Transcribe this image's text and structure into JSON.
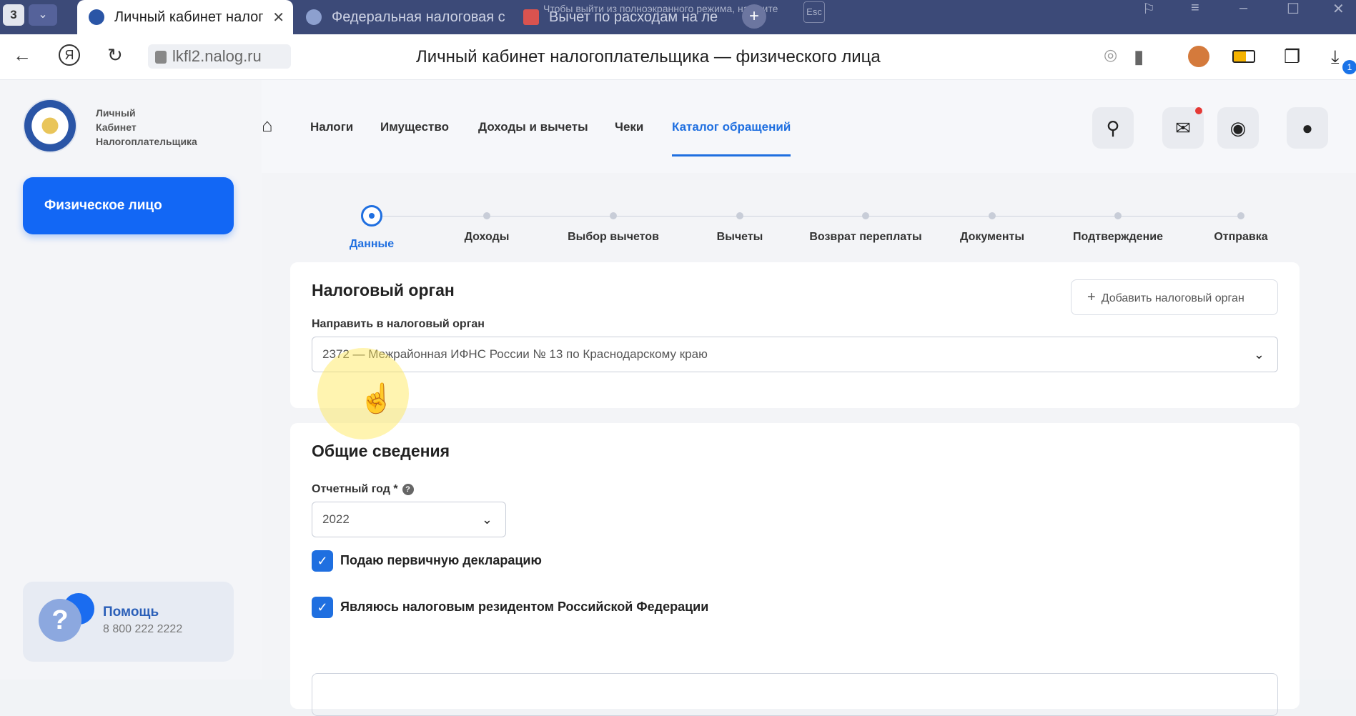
{
  "browser": {
    "tab_count": "3",
    "tabs": [
      {
        "title": "Личный кабинет налог"
      },
      {
        "title": "Федеральная налоговая с"
      },
      {
        "title": "Вычет по расходам на ле"
      }
    ],
    "close_glyph": "✕",
    "fullscreen_notice": "Чтобы выйти из полноэкранного режима, нажмите",
    "esc_key": "Esc",
    "url": "lkfl2.nalog.ru",
    "page_title": "Личный кабинет налогоплательщика — физического лица",
    "download_badge": "1"
  },
  "sidebar": {
    "logo_lines": [
      "Личный",
      "Кабинет",
      "Налогоплательщика"
    ],
    "person_button": "Физическое лицо",
    "help": {
      "title": "Помощь",
      "phone": "8 800 222 2222",
      "icon": "?"
    }
  },
  "topnav": {
    "items": [
      "Налоги",
      "Имущество",
      "Доходы и вычеты",
      "Чеки",
      "Каталог обращений"
    ],
    "active_index": 4
  },
  "steps": {
    "labels": [
      "Данные",
      "Доходы",
      "Выбор вычетов",
      "Вычеты",
      "Возврат переплаты",
      "Документы",
      "Подтверждение",
      "Отправка"
    ],
    "active_index": 0
  },
  "tax_authority": {
    "title": "Налоговый орган",
    "add_button": "Добавить налоговый орган",
    "add_icon": "+",
    "field_label": "Направить в налоговый орган",
    "selected": "2372 — Межрайонная ИФНС России № 13 по Краснодарскому краю"
  },
  "general": {
    "title": "Общие сведения",
    "year_label": "Отчетный год *",
    "year_value": "2022",
    "checkboxes": [
      {
        "label": "Подаю первичную декларацию",
        "checked": true
      },
      {
        "label": "Являюсь налоговым резидентом Российской Федерации",
        "checked": true
      }
    ]
  },
  "colors": {
    "accent": "#1f6fe0",
    "primary_button": "#1267f5",
    "tabbar": "#3c4a78"
  }
}
